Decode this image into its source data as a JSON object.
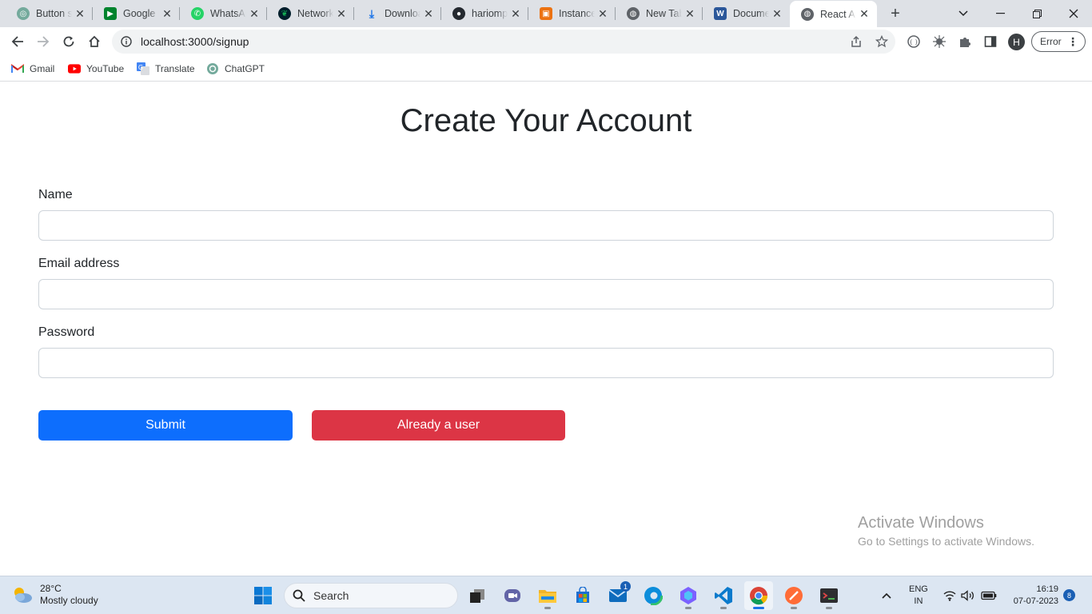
{
  "browser": {
    "tabs": [
      {
        "title": "Button s",
        "icon": "chatgpt-icon",
        "color": "#74aa9c",
        "glyph": "◎"
      },
      {
        "title": "Google I",
        "icon": "google-meet-icon",
        "color": "#00832d",
        "glyph": "▶"
      },
      {
        "title": "WhatsAp",
        "icon": "whatsapp-icon",
        "color": "#25d366",
        "glyph": "✆"
      },
      {
        "title": "Network",
        "icon": "mongodb-icon",
        "color": "#13aa52",
        "glyph": "❦"
      },
      {
        "title": "Downloa",
        "icon": "download-icon",
        "color": "#1a73e8",
        "glyph": "⤓"
      },
      {
        "title": "hariomp",
        "icon": "github-icon",
        "color": "#24292f",
        "glyph": "●"
      },
      {
        "title": "Instance",
        "icon": "aws-icon",
        "color": "#ec7211",
        "glyph": "▣"
      },
      {
        "title": "New Tab",
        "icon": "globe-icon",
        "color": "#5f6368",
        "glyph": "◍"
      },
      {
        "title": "Docume",
        "icon": "word-icon",
        "color": "#2b579a",
        "glyph": "W"
      },
      {
        "title": "React Ap",
        "icon": "globe-icon",
        "color": "#5f6368",
        "glyph": "◍"
      }
    ],
    "active_tab_index": 9,
    "url": "localhost:3000/signup",
    "profile_initial": "H",
    "error_label": "Error"
  },
  "bookmarks": [
    {
      "label": "Gmail",
      "icon": "gmail-icon"
    },
    {
      "label": "YouTube",
      "icon": "youtube-icon"
    },
    {
      "label": "Translate",
      "icon": "google-translate-icon"
    },
    {
      "label": "ChatGPT",
      "icon": "chatgpt-icon"
    }
  ],
  "page": {
    "title": "Create Your Account",
    "fields": {
      "name": {
        "label": "Name",
        "value": ""
      },
      "email": {
        "label": "Email address",
        "value": ""
      },
      "password": {
        "label": "Password",
        "value": ""
      }
    },
    "submit_label": "Submit",
    "login_label": "Already a user",
    "colors": {
      "primary": "#0d6efd",
      "danger": "#dc3545"
    }
  },
  "watermark": {
    "line1": "Activate Windows",
    "line2": "Go to Settings to activate Windows."
  },
  "taskbar": {
    "weather_temp": "28°C",
    "weather_desc": "Mostly cloudy",
    "search_label": "Search",
    "mail_badge": "1",
    "lang_line1": "ENG",
    "lang_line2": "IN",
    "time": "16:19",
    "date": "07-07-2023",
    "notification_count": "8"
  }
}
